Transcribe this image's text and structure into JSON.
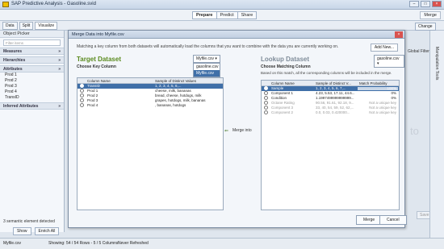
{
  "app": {
    "title": "SAP Predictive Analysis - Gasoline.svid"
  },
  "toolbar": {
    "modes": [
      "Prepare",
      "Predict",
      "Share"
    ],
    "right_items": [
      "Merge",
      "Change"
    ]
  },
  "subbar": {
    "tabs": [
      "Data",
      "Split",
      "Visualize"
    ]
  },
  "left_panel": {
    "title": "Object Picker",
    "filter_placeholder": "Filter items",
    "sections": {
      "measures": "Measures",
      "hierarchies": "Hierarchies",
      "attributes": "Attributes",
      "inferred": "Inferred Attributes"
    },
    "attributes": [
      "Prod 1",
      "Prod 2",
      "Prod 3",
      "Prod 4",
      "TransID"
    ],
    "status": "3 semantic element detected",
    "buttons": {
      "show": "Show",
      "enrich": "Enrich All"
    }
  },
  "status_bar": {
    "file": "Myfile.csv",
    "showing": "Showing: 54 / 54 Rows - 5 / 5 Columns",
    "refresh": "Never Refreshed"
  },
  "behind": {
    "change": "Change",
    "filters": "Global Filters",
    "to": "to",
    "save": "Save",
    "panel": "Manipulation Tools"
  },
  "dialog": {
    "title": "Merge Data into Myfile.csv",
    "description": "Matching a key column from both datasets will automatically load the columns that you want to combine with the data you are currently working on.",
    "add_new": "Add New...",
    "merge_into": "Merge into",
    "buttons": {
      "merge": "Merge",
      "cancel": "Cancel"
    },
    "target": {
      "title": "Target Dataset",
      "subtitle": "Choose Key Column",
      "dropdown_value": "Myfile.csv",
      "menu_options": [
        "gasoline.csv",
        "Myfile.csv"
      ],
      "columns": [
        "Column Name",
        "Sample of Distinct Values"
      ],
      "rows": [
        {
          "name": "TransID",
          "sample": "1, 2, 3, 4, 5, 6,..."
        },
        {
          "name": "Prod 1",
          "sample": "cheese, milk, bananas"
        },
        {
          "name": "Prod 2",
          "sample": "bread, cheese, hotdogs, milk"
        },
        {
          "name": "Prod 3",
          "sample": "grapes, hotdogs, milk, bananas"
        },
        {
          "name": "Prod 4",
          "sample": ", bananas, hotdogs"
        }
      ]
    },
    "lookup": {
      "title": "Lookup Dataset",
      "subtitle": "Choose Matching Column",
      "note": "Based on this match, all the corresponding columns will be included in the merge.",
      "dropdown_value": "gasoline.csv",
      "columns": [
        "Column Name",
        "Sample of Distinct V...",
        "Match Probability"
      ],
      "rows": [
        {
          "name": "Sample",
          "sample": "1, 2, 3, 4, 5, 6, 7,...",
          "prob": "100%",
          "p": 1.0
        },
        {
          "name": "Component 1",
          "sample": "4.23, 5.53, 17.11, 44.6...",
          "prob": "0%",
          "p": 0
        },
        {
          "name": "Condition",
          "sample": "1.1997499999999999...",
          "prob": "0%",
          "p": 0
        },
        {
          "name": "Octane Rating",
          "sample": "90.56, 91.61, 92.18, 9...",
          "prob": "Not a unique key",
          "p": 0
        },
        {
          "name": "Component 3",
          "sample": "33, 40, 54, 59, 52, 62,...",
          "prob": "Not a unique key",
          "p": 0
        },
        {
          "name": "Component 2",
          "sample": "0.0, 0.03, 0.420000...",
          "prob": "Not a unique key",
          "p": 0
        }
      ]
    }
  }
}
